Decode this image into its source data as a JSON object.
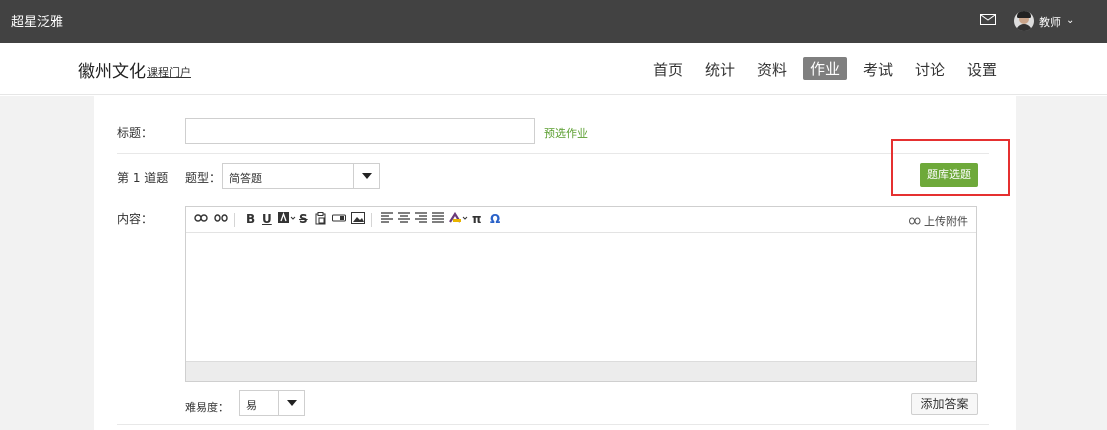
{
  "topbar": {
    "brand": "超星泛雅",
    "user_name": "教师",
    "user_chevron": "⌄",
    "icons": [
      "mail-icon",
      "avatar"
    ]
  },
  "header": {
    "course_title": "徽州文化",
    "course_subtitle": "课程门户",
    "nav": [
      {
        "label": "首页",
        "active": false
      },
      {
        "label": "统计",
        "active": false
      },
      {
        "label": "资料",
        "active": false
      },
      {
        "label": "作业",
        "active": true
      },
      {
        "label": "考试",
        "active": false
      },
      {
        "label": "讨论",
        "active": false
      },
      {
        "label": "设置",
        "active": false
      }
    ]
  },
  "form": {
    "title_label": "标题：",
    "title_value": "",
    "preview_link": "预选作业",
    "question_label": "第 1 道题",
    "type_label": "题型：",
    "type_value": "简答题",
    "bank_button": "题库选题",
    "content_label": "内容：",
    "upload_label": "上传附件",
    "difficulty_label": "难易度：",
    "difficulty_value": "易",
    "add_answer": "添加答案"
  },
  "toolbar": {
    "tools": [
      "link-icon",
      "unlink-icon",
      "bold-icon",
      "underline-icon",
      "font-color-icon",
      "strikethrough-icon",
      "paste-icon",
      "input-icon",
      "image-icon",
      "align-left-icon",
      "align-center-icon",
      "align-right-icon",
      "justify-icon",
      "highlight-icon",
      "pi-icon",
      "omega-icon"
    ],
    "bold": "B",
    "underline": "U",
    "strike": "S",
    "pi": "π",
    "omega": "Ω"
  },
  "colors": {
    "topbar": "#424242",
    "accent_green": "#6ea93a",
    "highlight_red": "#e53030",
    "nav_active": "#7f7f7f"
  }
}
